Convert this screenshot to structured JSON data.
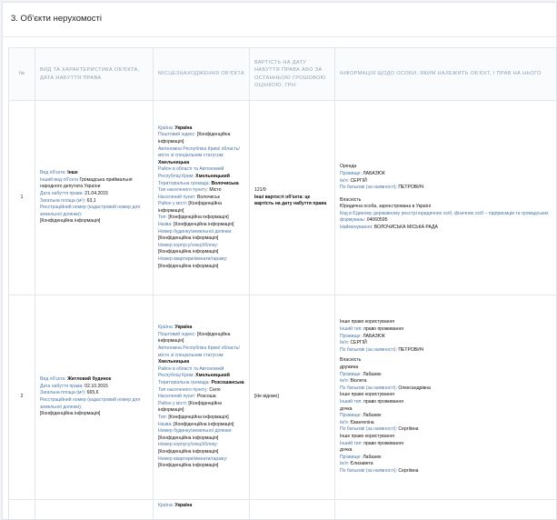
{
  "section": {
    "title": "3. Об'єкти нерухомості"
  },
  "table": {
    "headers": {
      "num": "№",
      "type": "Вид та характеристика об'єкта, дата набуття права",
      "location": "Місцезнаходження об'єкта",
      "value": "Вартість на дату набуття права або за останньою грошовою оцінкою, грн",
      "owner": "Інформація щодо особи, яким належить об'єкт, і прав на нього"
    },
    "rows": [
      {
        "num": "1",
        "type": {
          "kind_k": "Вид об'єкта:",
          "kind_v": "Інше",
          "other_k": "Інший вид об'єкта",
          "other_v": "Громадська приймальня народного депутата України",
          "date_k": "Дата набуття права:",
          "date_v": "21.04.2015",
          "area_k": "Загальна площа (м²):",
          "area_v": "63,1",
          "reg_k": "Реєстраційний номер (кадастровий номер для земельної ділянки):",
          "reg_v": "[Конфіденційна інформація]"
        },
        "location": {
          "country_k": "Країна:",
          "country_v": "Україна",
          "postcode_k": "Поштовий індекс:",
          "postcode_v": "[Конфіденційна інформація]",
          "region_k": "Автономна Республіка Крим/ область/місто зі спеціальним статусом:",
          "region_v": "Хмельницька",
          "district_k": "Район в області та Автономній Республіці Крим:",
          "district_v": "Хмельницький",
          "community_k": "Територіальна громада:",
          "community_v": "Волочиська",
          "settle_type_k": "Тип населеного пункту:",
          "settle_type_v": "Місто",
          "settle_k": "Населений пункт:",
          "settle_v": "Волочиськ",
          "city_district_k": "Район у місті:",
          "city_district_v": "[Конфіденційна інформація]",
          "street_type_k": "Тип:",
          "street_type_v": "[Конфіденційна інформація]",
          "street_k": "Назва:",
          "street_v": "[Конфіденційна інформація]",
          "house_k": "Номер будинку/земельної ділянки:",
          "house_v": "[Конфіденційна інформація]",
          "block_k": "Номер корпусу/секції/блоку:",
          "block_v": "[Конфіденційна інформація]",
          "apt_k": "Номер квартири/кімнати/гаражу:",
          "apt_v": "[Конфіденційна інформація]"
        },
        "value": {
          "amount": "121/9",
          "note": "Інші вартості об'єкта: це вартість на дату набуття права"
        },
        "owner": {
          "right": "Оренда",
          "surname_k": "Прізвище:",
          "surname_v": "ЛАБАЗЮК",
          "name_k": "Ім'я:",
          "name_v": "СЕРГІЙ",
          "patr_k": "По батькові (за наявності):",
          "patr_v": "ПЕТРОВИЧ",
          "ownership": "Власність",
          "entity": "Юридична особа, зареєстрована в Україні",
          "edrpou_k": "Код в Єдиному державному реєстрі юридичних осіб, фізичних осіб – підприємців та громадських формувань:",
          "edrpou_v": "04060595",
          "title_k": "Найменування:",
          "title_v": "ВОЛОЧИСЬКА МІСЬКА РАДА"
        }
      },
      {
        "num": "2",
        "type": {
          "kind_k": "Вид об'єкта:",
          "kind_v": "Житловий будинок",
          "date_k": "Дата набуття права:",
          "date_v": "02.10.2015",
          "area_k": "Загальна площа (м²):",
          "area_v": "665,6",
          "reg_k": "Реєстраційний номер (кадастровий номер для земельної ділянки):",
          "reg_v": "[Конфіденційна інформація]"
        },
        "location": {
          "country_k": "Країна:",
          "country_v": "Україна",
          "postcode_k": "Поштовий індекс:",
          "postcode_v": "[Конфіденційна інформація]",
          "region_k": "Автономна Республіка Крим/ область/місто зі спеціальним статусом:",
          "region_v": "Хмельницька",
          "district_k": "Район в області та Автономній Республіці Крим:",
          "district_v": "Хмельницький",
          "community_k": "Територіальна громада:",
          "community_v": "Розсошанська",
          "settle_type_k": "Тип населеного пункту:",
          "settle_type_v": "Село",
          "settle_k": "Населений пункт:",
          "settle_v": "Розсоша",
          "city_district_k": "Район у місті:",
          "city_district_v": "[Конфіденційна інформація]",
          "street_type_k": "Тип:",
          "street_type_v": "[Конфіденційна інформація]",
          "street_k": "Назва:",
          "street_v": "[Конфіденційна інформація]",
          "house_k": "Номер будинку/земельної ділянки:",
          "house_v": "[Конфіденційна інформація]",
          "block_k": "Номер корпусу/секції/блоку:",
          "block_v": "[Конфіденційна інформація]",
          "apt_k": "Номер квартири/кімнати/гаражу:",
          "apt_v": "[Конфіденційна інформація]"
        },
        "value": {
          "amount": "[Не відомо]"
        },
        "owner": {
          "r1": "Інше право користування",
          "r1_type_k": "Інший тип:",
          "r1_type_v": "право проживання",
          "r1_surname_k": "Прізвище:",
          "r1_surname_v": "ЛАБАЗЮК",
          "r1_name_k": "Ім'я:",
          "r1_name_v": "СЕРГІЙ",
          "r1_patr_k": "По батькові (за наявності):",
          "r1_patr_v": "ПЕТРОВИЧ",
          "ownership": "Власність",
          "rel1": "дружина",
          "o_surname_k": "Прізвище:",
          "o_surname_v": "Лабазюк",
          "o_name_k": "Ім'я:",
          "o_name_v": "Віолета",
          "o_patr_k": "По батькові (за наявності):",
          "o_patr_v": "Олександрівна",
          "r2": "Інше право користування",
          "r2_type_k": "Інший тип:",
          "r2_type_v": "право проживання",
          "rel2": "дочка",
          "d1_surname_k": "Прізвище:",
          "d1_surname_v": "Лабазюк",
          "d1_name_k": "Ім'я:",
          "d1_name_v": "Євангеліна",
          "d1_patr_k": "По батькові (за наявності):",
          "d1_patr_v": "Сергіївна",
          "r3": "Інше право користування",
          "r3_type_k": "Інший тип:",
          "r3_type_v": "право проживання",
          "rel3": "дочка",
          "d2_surname_k": "Прізвище:",
          "d2_surname_v": "Лабазюк",
          "d2_name_k": "Ім'я:",
          "d2_name_v": "Єлизавета",
          "d2_patr_k": "По батькові (за наявності):",
          "d2_patr_v": "Сергіївна"
        }
      },
      {
        "location": {
          "country_k": "Країна:",
          "country_v": "Україна"
        }
      }
    ]
  }
}
